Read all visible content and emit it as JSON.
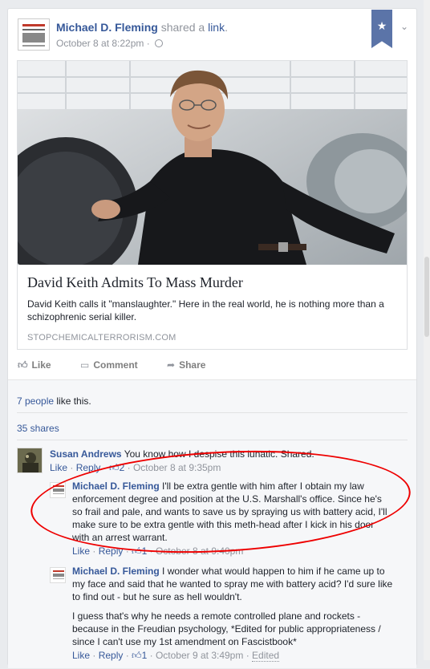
{
  "post": {
    "author": "Michael D. Fleming",
    "shared_text": "shared a",
    "shared_link": "link",
    "shared_period": ".",
    "timestamp": "October 8 at 8:22pm",
    "separator": "·",
    "star_icon": "star-icon",
    "globe_icon": "globe-icon"
  },
  "link": {
    "title": "David Keith Admits To Mass Murder",
    "description": "David Keith calls it \"manslaughter.\" Here in the real world, he is nothing more than a schizophrenic serial killer.",
    "domain": "STOPCHEMICALTERRORISM.COM"
  },
  "actions": {
    "like": "Like",
    "comment": "Comment",
    "share": "Share"
  },
  "feedback": {
    "likes_link": "7 people",
    "likes_suffix": " like this.",
    "shares": "35 shares"
  },
  "comments": [
    {
      "author": "Susan Andrews",
      "text": "You know how I despise this lunatic. Shared.",
      "like": "Like",
      "reply": "Reply",
      "like_count": "2",
      "time": "October 8 at 9:35pm"
    },
    {
      "author": "Michael D. Fleming",
      "text": "I'll be extra gentle with him after I obtain my law enforcement degree and position at the U.S. Marshall's office. Since he's so frail and pale, and wants to save us by spraying us with battery acid, I'll make sure to be extra gentle with this meth-head after I kick in his door with an arrest warrant.",
      "like": "Like",
      "reply": "Reply",
      "like_count": "1",
      "time": "October 8 at 9:40pm"
    },
    {
      "author": "Michael D. Fleming",
      "text": "I wonder what would happen to him if he came up to my face and said that he wanted to spray me with battery acid? I'd sure like to find out - but he sure as hell wouldn't.",
      "text2": "I guess that's why he needs a remote controlled plane and rockets - because in the Freudian psychology, *Edited for public appropriateness / since I can't use my 1st amendment on Fascistbook*",
      "like": "Like",
      "reply": "Reply",
      "like_count": "1",
      "time": "October 9 at 3:49pm",
      "edited": "Edited"
    }
  ],
  "colors": {
    "link_blue": "#365899",
    "muted": "#90949c",
    "annotation_red": "#ee0000"
  }
}
